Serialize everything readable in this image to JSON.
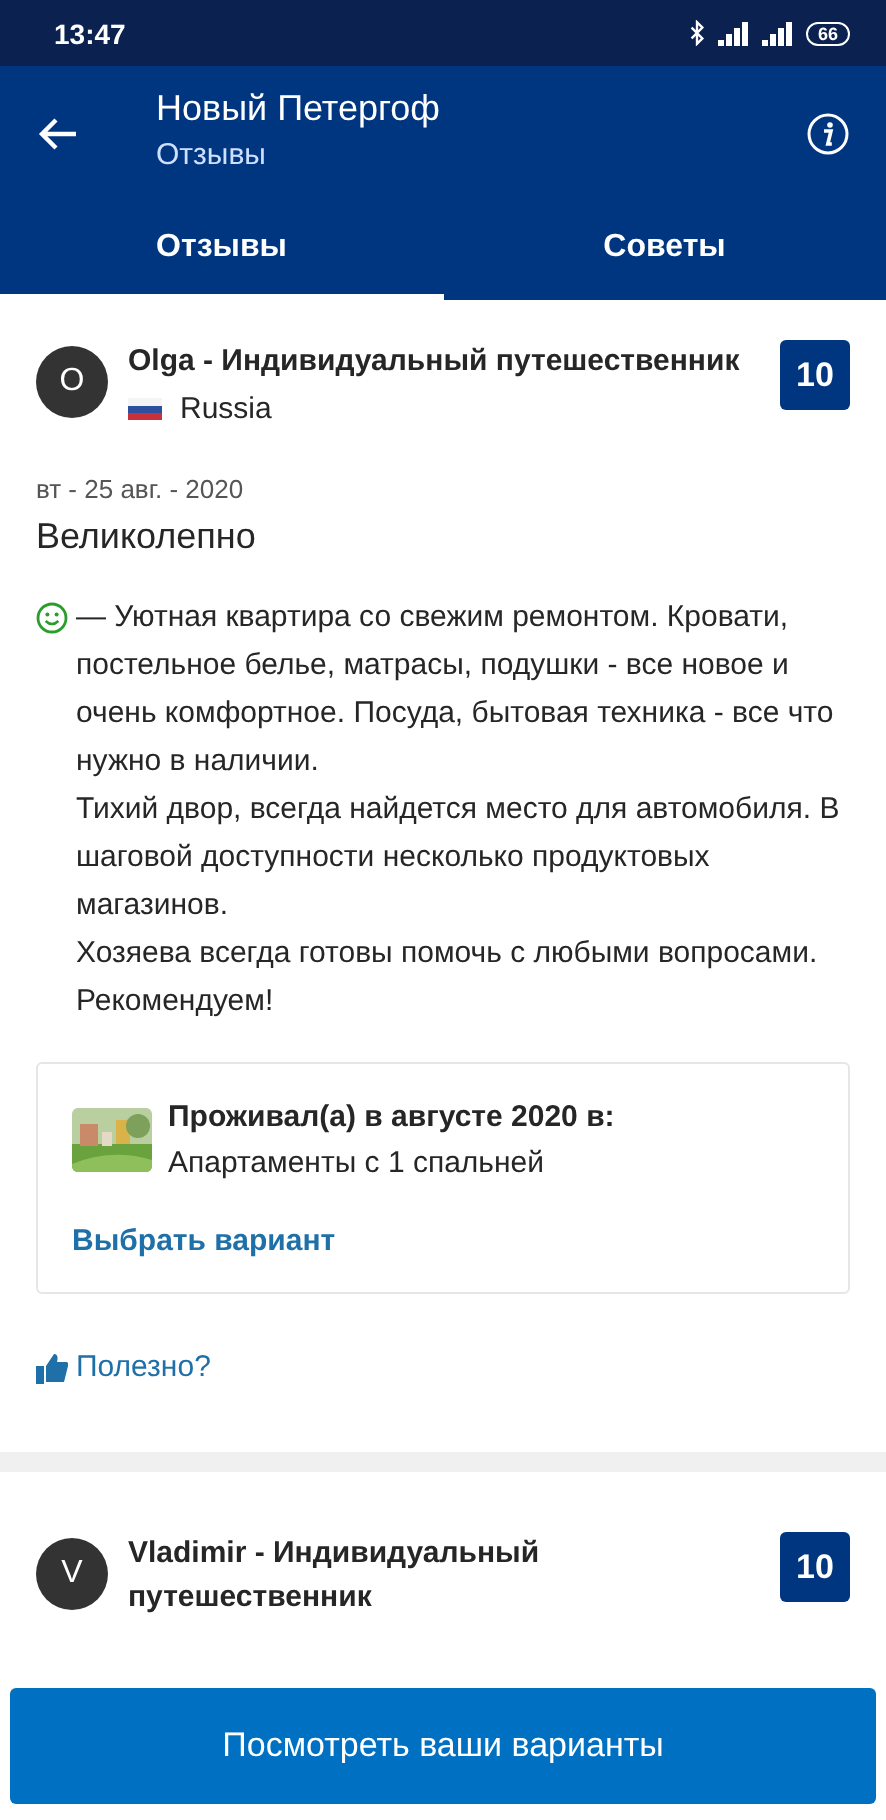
{
  "status_bar": {
    "time": "13:47",
    "battery": "66"
  },
  "header": {
    "title": "Новый Петергоф",
    "subtitle": "Отзывы"
  },
  "tabs": [
    {
      "label": "Отзывы",
      "selected": true
    },
    {
      "label": "Советы",
      "selected": false
    }
  ],
  "reviews": [
    {
      "initial": "O",
      "author": "Olga - Индивидуальный путешественник",
      "country": "Russia",
      "score": "10",
      "date": "вт - 25 авг. - 2020",
      "title": "Великолепно",
      "positive": true,
      "text": "— Уютная квартира со свежим ремонтом. Кровати, постельное белье, матрасы, подушки - все новое и очень комфортное. Посуда, бытовая техника - все что нужно в наличии.\nТихий двор, всегда найдется место для автомобиля. В шаговой доступности несколько продуктовых магазинов.\nХозяева всегда готовы помочь с любыми вопросами.\nРекомендуем!",
      "stay": {
        "heading": "Проживал(а) в августе 2020 в:",
        "room": "Апартаменты с 1 спальней",
        "link": "Выбрать вариант"
      },
      "helpful": "Полезно?"
    },
    {
      "initial": "V",
      "author": "Vladimir - Индивидуальный путешественник",
      "score": "10"
    }
  ],
  "footer_button": "Посмотреть ваши варианты"
}
